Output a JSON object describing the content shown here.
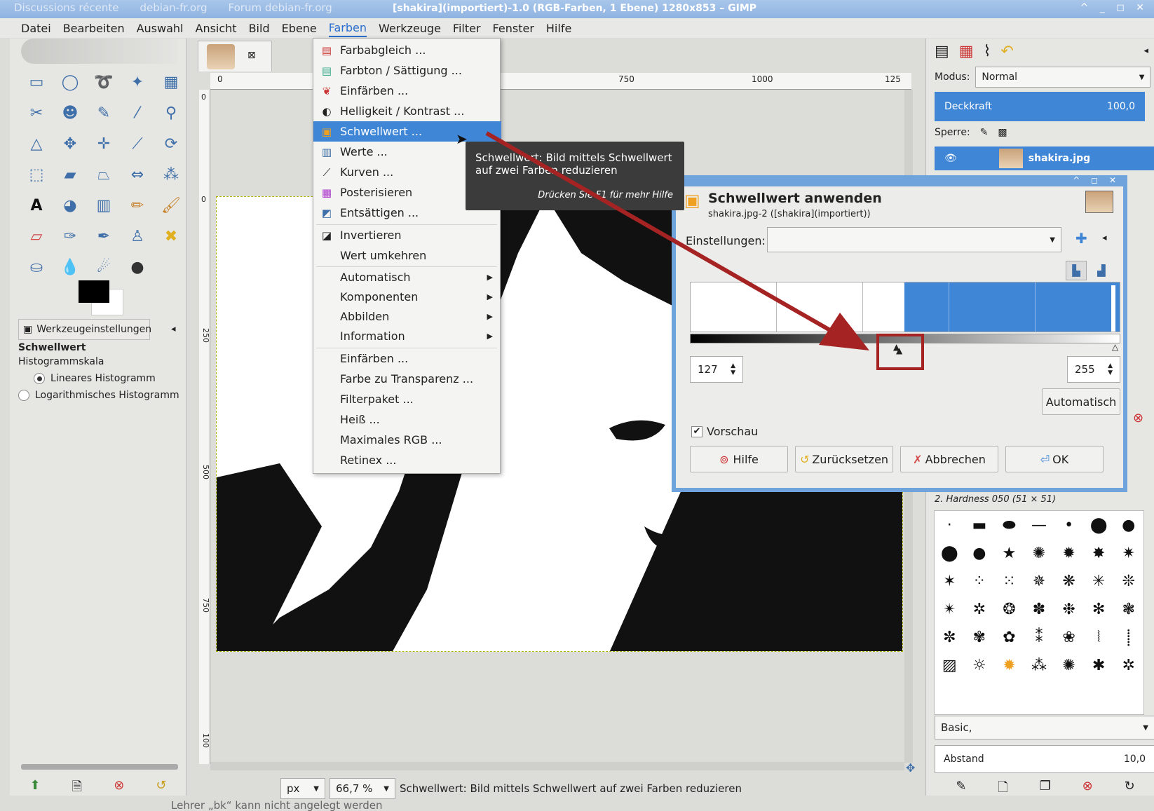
{
  "browser": {
    "tabs": [
      "Discussions récente",
      "debian-fr.org",
      "Forum debian-fr.org"
    ],
    "title": "[shakira](importiert)-1.0 (RGB-Farben, 1 Ebene) 1280x853 – GIMP"
  },
  "menubar": [
    "Datei",
    "Bearbeiten",
    "Auswahl",
    "Ansicht",
    "Bild",
    "Ebene",
    "Farben",
    "Werkzeuge",
    "Filter",
    "Fenster",
    "Hilfe"
  ],
  "farben_menu": [
    {
      "label": "Farbabgleich ...",
      "icon": "color-balance-icon"
    },
    {
      "label": "Farbton / Sättigung ...",
      "icon": "hue-saturation-icon"
    },
    {
      "label": "Einfärben ...",
      "icon": "colorize-icon"
    },
    {
      "label": "Helligkeit / Kontrast ...",
      "icon": "brightness-contrast-icon"
    },
    {
      "label": "Schwellwert ...",
      "icon": "threshold-icon",
      "selected": true
    },
    {
      "label": "Werte ...",
      "icon": "levels-icon"
    },
    {
      "label": "Kurven ...",
      "icon": "curves-icon"
    },
    {
      "label": "Posterisieren",
      "icon": "posterize-icon"
    },
    {
      "label": "Entsättigen ...",
      "icon": "desaturate-icon"
    },
    {
      "label": "Invertieren",
      "icon": "invert-icon"
    },
    {
      "label": "Wert umkehren",
      "icon": ""
    },
    {
      "label": "Automatisch",
      "submenu": true
    },
    {
      "label": "Komponenten",
      "submenu": true
    },
    {
      "label": "Abbilden",
      "submenu": true
    },
    {
      "label": "Information",
      "submenu": true
    },
    {
      "label": "Einfärben ..."
    },
    {
      "label": "Farbe zu Transparenz ..."
    },
    {
      "label": "Filterpaket ..."
    },
    {
      "label": "Heiß ..."
    },
    {
      "label": "Maximales RGB ..."
    },
    {
      "label": "Retinex ..."
    }
  ],
  "tooltip": {
    "text": "Schwellwert: Bild mittels Schwellwert auf zwei Farben reduzieren",
    "hint": "Drücken Sie F1 für mehr Hilfe"
  },
  "tool_options": {
    "tab": "Werkzeugeinstellungen",
    "heading": "Schwellwert",
    "subheading": "Histogrammskala",
    "options": [
      "Lineares Histogramm",
      "Logarithmisches Histogramm"
    ],
    "selected": 0
  },
  "ruler": {
    "top_ticks": [
      "0",
      "750",
      "1000",
      "125"
    ],
    "left_ticks": [
      "0",
      "0",
      "250",
      "500",
      "750",
      "100"
    ]
  },
  "dialog": {
    "title": "Schwellwert anwenden",
    "subtitle": "shakira.jpg-2 ([shakira](importiert))",
    "settings_label": "Einstellungen:",
    "low": "127",
    "high": "255",
    "auto_button": "Automatisch",
    "preview_label": "Vorschau",
    "buttons": {
      "help": "Hilfe",
      "reset": "Zurücksetzen",
      "cancel": "Abbrechen",
      "ok": "OK"
    }
  },
  "layers": {
    "mode_label": "Modus:",
    "mode_value": "Normal",
    "opacity_label": "Deckkraft",
    "opacity_value": "100,0",
    "lock_label": "Sperre:",
    "layer_name": "shakira.jpg"
  },
  "brushes": {
    "title": "2. Hardness 050 (51 × 51)",
    "preset": "Basic,",
    "spacing_label": "Abstand",
    "spacing_value": "10,0"
  },
  "statusbar": {
    "unit": "px",
    "zoom": "66,7 %",
    "message": "Schwellwert: Bild mittels Schwellwert auf zwei Farben reduzieren"
  },
  "background_text": "Lehrer „bk“ kann nicht angelegt werden",
  "colors": {
    "accent": "#3f86d6",
    "annotation": "#a52323"
  }
}
